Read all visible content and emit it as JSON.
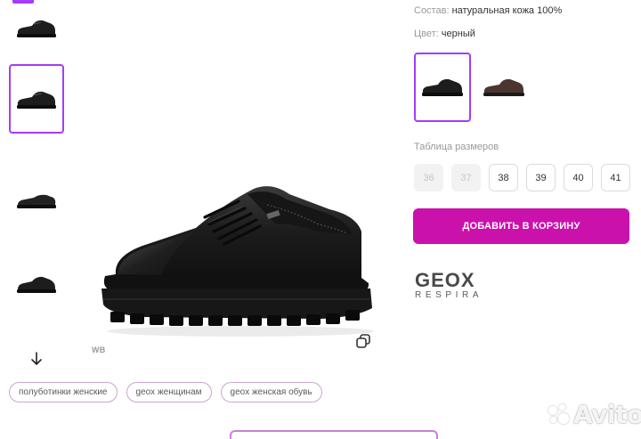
{
  "specs": {
    "composition_label": "Состав:",
    "composition_value": "натуральная кожа 100%",
    "color_label": "Цвет:",
    "color_value": "черный"
  },
  "color_options": [
    {
      "name": "black",
      "selected": true
    },
    {
      "name": "brown",
      "selected": false
    }
  ],
  "sizes": {
    "title": "Таблица размеров",
    "items": [
      {
        "label": "36",
        "available": false
      },
      {
        "label": "37",
        "available": false
      },
      {
        "label": "38",
        "available": true
      },
      {
        "label": "39",
        "available": true
      },
      {
        "label": "40",
        "available": true
      },
      {
        "label": "41",
        "available": true
      }
    ]
  },
  "cart": {
    "add_label": "ДОБАВИТЬ В КОРЗИНУ"
  },
  "brand": {
    "name": "GEOX",
    "sub": "RESPIRA"
  },
  "gallery": {
    "wb_label": "WB",
    "selected_thumb": 2,
    "thumb_count": 4
  },
  "tags": [
    "полуботинки женские",
    "geox женщинам",
    "geox женская обувь"
  ],
  "watermark": {
    "text": "Avito"
  },
  "colors": {
    "accent": "#a73afd",
    "button": "#cb11ab",
    "tag_border": "#c9a5cf"
  },
  "icons": [
    "arrow-down-icon",
    "copy-icon",
    "avito-logo"
  ]
}
